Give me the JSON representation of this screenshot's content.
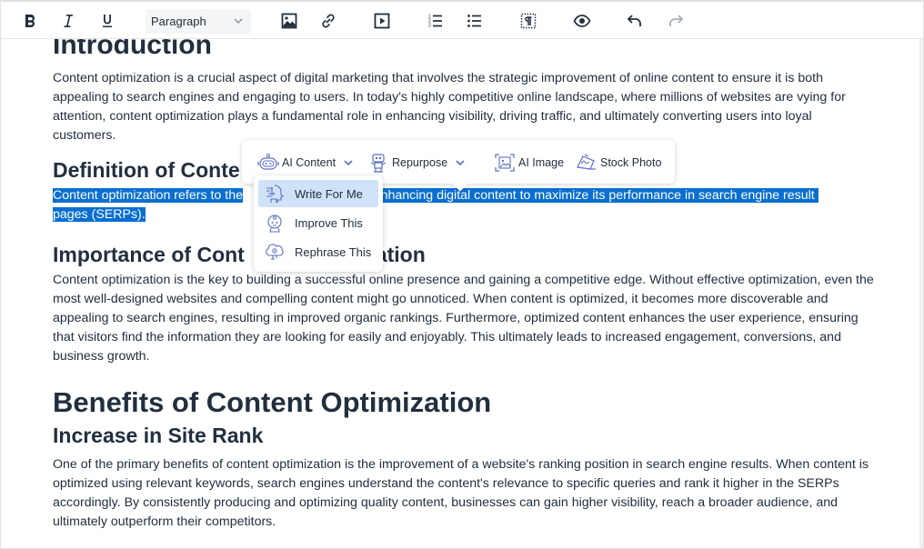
{
  "toolbar": {
    "buttons": {
      "bold": "bold-icon",
      "italic": "italic-icon",
      "underline": "underline-icon",
      "image": "image-icon",
      "link": "link-icon",
      "media": "media-play-icon",
      "ordered_list": "ordered-list-icon",
      "bullet_list": "bullet-list-icon",
      "show_blocks": "show-blocks-icon",
      "preview": "eye-icon",
      "undo": "undo-icon",
      "redo": "redo-icon"
    },
    "block_format": "Paragraph",
    "redo_disabled": true
  },
  "document": {
    "intro_heading": "Introduction",
    "intro_paragraph": "Content optimization is a crucial aspect of digital marketing that involves the strategic improvement of online content to ensure it is both appealing to search engines and engaging to users. In today's highly competitive online landscape, where millions of websites are vying for attention, content optimization plays a fundamental role in enhancing visibility, driving traffic, and ultimately converting users into loyal customers.",
    "definition_heading_visible": "Definition of Conte",
    "definition_selected_start": "Content optimization refers to the",
    "definition_selected_end": "nd enhancing digital content to maximize its performance in search engine result",
    "definition_selected_line2": "pages (SERPs).",
    "importance_heading_start": "Importance of Cont",
    "importance_heading_end": "ation",
    "importance_paragraph": "Content optimization is the key to building a successful online presence and gaining a competitive edge. Without effective optimization, even the most well-designed websites and compelling content might go unnoticed. When content is optimized, it becomes more discoverable and appealing to search engines, resulting in improved organic rankings. Furthermore, optimized content enhances the user experience, ensuring that visitors find the information they are looking for easily and enjoyably. This ultimately leads to increased engagement, conversions, and business growth.",
    "benefits_heading": "Benefits of Content Optimization",
    "site_rank_heading": "Increase in Site Rank",
    "site_rank_paragraph": "One of the primary benefits of content optimization is the improvement of a website's ranking position in search engine results. When content is optimized using relevant keywords, search engines understand the content's relevance to specific queries and rank it higher in the SERPs accordingly. By consistently producing and optimizing quality content, businesses can gain higher visibility, reach a broader audience, and ultimately outperform their competitors."
  },
  "ai_toolbar": {
    "items": [
      {
        "label": "AI Content",
        "icon": "ai-robot-icon",
        "has_dropdown": true
      },
      {
        "label": "Repurpose",
        "icon": "repurpose-robot-icon",
        "has_dropdown": true
      },
      {
        "label": "AI Image",
        "icon": "ai-image-icon",
        "has_dropdown": false
      },
      {
        "label": "Stock Photo",
        "icon": "stock-photo-icon",
        "has_dropdown": false
      }
    ],
    "accent_color": "#5b6fbf"
  },
  "ai_content_menu": {
    "items": [
      {
        "label": "Write For Me",
        "icon": "write-for-me-icon",
        "active": true
      },
      {
        "label": "Improve This",
        "icon": "improve-this-icon",
        "active": false
      },
      {
        "label": "Rephrase This",
        "icon": "rephrase-this-icon",
        "active": false
      }
    ]
  },
  "colors": {
    "selection": "#0a6fd1",
    "menu_active": "#cfe2f8",
    "text": "#222f3e"
  }
}
